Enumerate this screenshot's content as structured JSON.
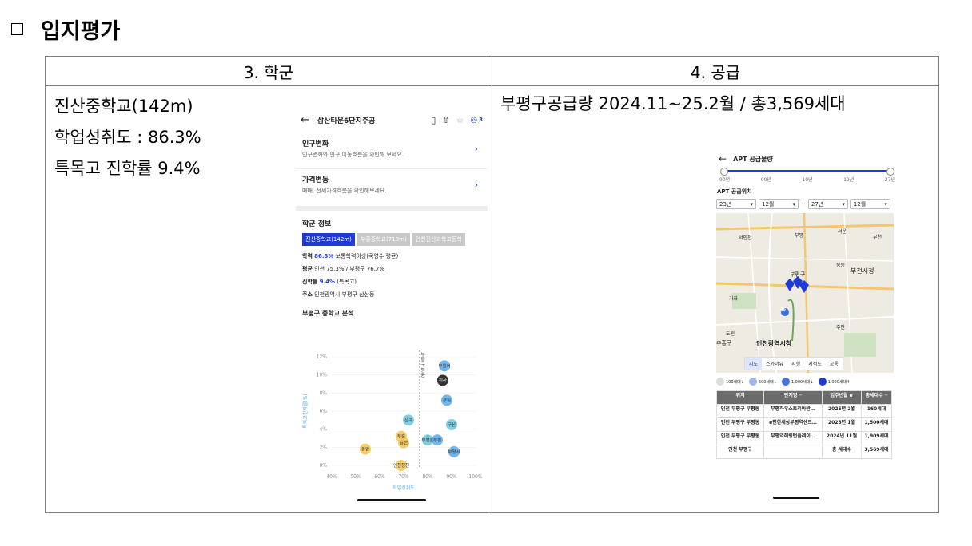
{
  "heading": {
    "bullet": "□",
    "title": "입지평가"
  },
  "table": {
    "col1_header": "3. 학군",
    "col2_header": "4. 공급",
    "col1_lines": [
      "진산중학교(142m)",
      "학업성취도 : 86.3%",
      "특목고 진학률 9.4%"
    ],
    "col2_line": "부평구공급량 2024.11~25.2월  / 총3,569세대"
  },
  "school_screen": {
    "header_title": "삼산타운6단지주공",
    "badge_count": "3",
    "menu": [
      {
        "title": "인구변화",
        "desc": "인구변화와 인구 이동흐름을 확인해 보세요."
      },
      {
        "title": "가격변동",
        "desc": "매매, 전세가격흐름을 확인해보세요."
      }
    ],
    "section_title": "학군 정보",
    "tabs": [
      "진산중학교(142m)",
      "부흥중학교(718m)",
      "인천진산과학고등학"
    ],
    "info": {
      "l1_label": "학력",
      "l1_value": "86.3%",
      "l1_rest": "보통학력이상(국영수 평균)",
      "l2_label": "평균",
      "l2_rest": "인천 75.3% / 부평구 76.7%",
      "l3_label": "진학률",
      "l3_value": "9.4%",
      "l3_rest": "(특목고)",
      "l4_label": "주소",
      "l4_rest": "인천광역시 부평구 삼산동"
    },
    "chart_title": "부평구 중학교 분석",
    "chart_data": {
      "type": "scatter",
      "xlabel": "학업성취도",
      "ylabel": "특목고진학률(%)",
      "xlim": [
        40,
        100
      ],
      "ylim": [
        0,
        12
      ],
      "x_ticks": [
        "40%",
        "50%",
        "60%",
        "70%",
        "80%",
        "90%",
        "100%"
      ],
      "y_ticks": [
        "0%",
        "2%",
        "4%",
        "6%",
        "8%",
        "10%",
        "12%"
      ],
      "avg_label": "부평구 평균",
      "avg_x": 76.7,
      "points": [
        {
          "label": "부원여",
          "x": 87,
          "y": 11.0,
          "color": "#5aa9e6"
        },
        {
          "label": "진산",
          "x": 86.3,
          "y": 9.4,
          "color": "#111111"
        },
        {
          "label": "부원",
          "x": 88,
          "y": 7.2,
          "color": "#5aa9e6"
        },
        {
          "label": "구산",
          "x": 90,
          "y": 4.5,
          "color": "#6cc6d9"
        },
        {
          "label": "산곡",
          "x": 72,
          "y": 5.0,
          "color": "#6cc6d9"
        },
        {
          "label": "부평서",
          "x": 91,
          "y": 1.5,
          "color": "#5aa9e6"
        },
        {
          "label": "부평동",
          "x": 80,
          "y": 2.8,
          "color": "#6cc6d9"
        },
        {
          "label": "부평",
          "x": 84,
          "y": 2.8,
          "color": "#5aa9e6"
        },
        {
          "label": "갈산",
          "x": 70,
          "y": 2.5,
          "color": "#f3c44f"
        },
        {
          "label": "부흥",
          "x": 69,
          "y": 3.2,
          "color": "#f3c44f"
        },
        {
          "label": "동암",
          "x": 54,
          "y": 1.8,
          "color": "#f3c44f"
        },
        {
          "label": "인천청천",
          "x": 69,
          "y": 0.0,
          "color": "#f3c44f"
        }
      ]
    }
  },
  "supply_screen": {
    "header_title": "APT 공급물량",
    "timeline_labels": [
      "90년",
      "00년",
      "10년",
      "19년",
      "27년"
    ],
    "section_label": "APT 공급위치",
    "selects": [
      "23년",
      "12월",
      "27년",
      "12월"
    ],
    "map_labels": [
      "서인천",
      "부평",
      "서운",
      "부천",
      "중동",
      "부천시청",
      "부평구",
      "가좌",
      "도원",
      "인천광역시청",
      "주안",
      "추흥구"
    ],
    "map_route": "46",
    "map_tabs": [
      "지도",
      "스카이뷰",
      "지형",
      "지적도",
      "교통"
    ],
    "legend": [
      "100세대↓",
      "500세대↓",
      "1,000세대↓",
      "1,000세대↑"
    ],
    "apt_table": {
      "headers": [
        "위치",
        "단지명 ─",
        "입주년월 ∨",
        "총세대수 ─"
      ],
      "rows": [
        [
          "인천 부평구 부평동",
          "부평하우스트리아반…",
          "2025년 2월",
          "160세대"
        ],
        [
          "인천 부평구 부평동",
          "e편한세상부평역센트…",
          "2025년 1월",
          "1,500세대"
        ],
        [
          "인천 부평구 부평동",
          "부평역해링턴플레이…",
          "2024년 11월",
          "1,909세대"
        ],
        [
          "인천 부평구",
          "",
          "총 세대수",
          "3,569세대"
        ]
      ]
    }
  }
}
